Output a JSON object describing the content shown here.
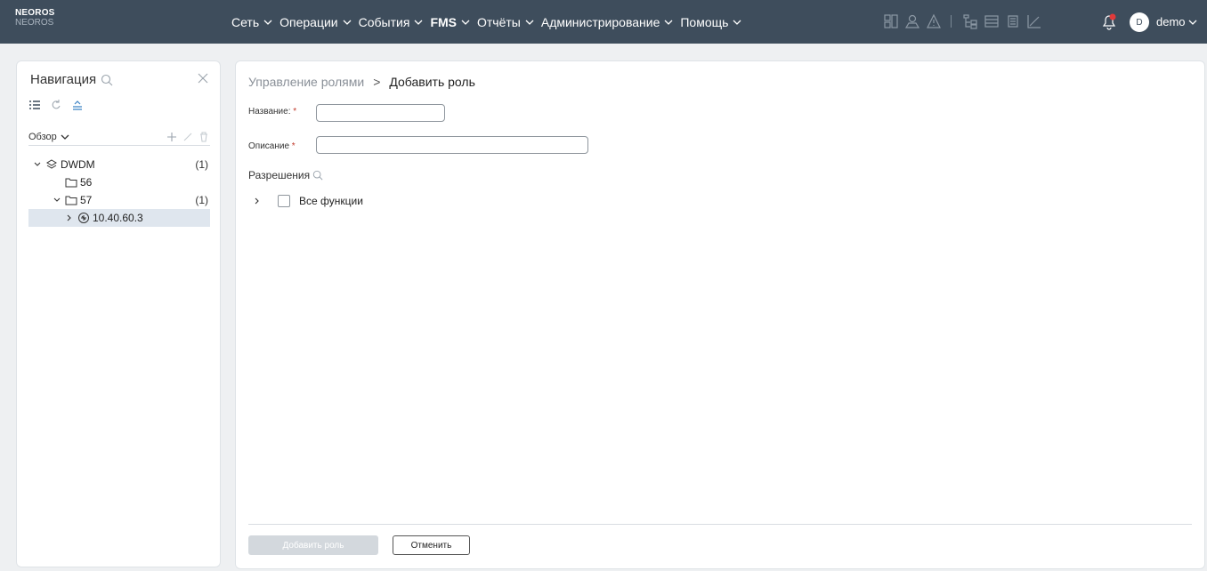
{
  "brand": {
    "name": "NEOROS",
    "subname": "NEOROS"
  },
  "menu": [
    {
      "label": "Сеть",
      "bold": false
    },
    {
      "label": "Операции",
      "bold": false
    },
    {
      "label": "События",
      "bold": false
    },
    {
      "label": "FMS",
      "bold": true
    },
    {
      "label": "Отчёты",
      "bold": false
    },
    {
      "label": "Администрирование",
      "bold": false
    },
    {
      "label": "Помощь",
      "bold": false
    }
  ],
  "toolbar_icons": [
    "topology-icon",
    "map-icon",
    "alarm-icon",
    "tree-icon",
    "table-icon",
    "inventory-icon",
    "chart-icon"
  ],
  "user": {
    "avatar_letter": "D",
    "name": "demo"
  },
  "nav": {
    "title": "Навигация",
    "overview_label": "Обзор",
    "tree": [
      {
        "label": "DWDM",
        "count": "(1)",
        "level": 0,
        "expanded": true,
        "icon": "layers-icon"
      },
      {
        "label": "56",
        "count": "",
        "level": 1,
        "expanded": false,
        "icon": "folder-icon"
      },
      {
        "label": "57",
        "count": "(1)",
        "level": 1,
        "expanded": true,
        "icon": "folder-icon"
      },
      {
        "label": "10.40.60.3",
        "count": "",
        "level": 2,
        "expanded": false,
        "icon": "device-icon",
        "selected": true
      }
    ]
  },
  "main": {
    "breadcrumb": {
      "parent": "Управление ролями",
      "separator": ">",
      "current": "Добавить роль"
    },
    "name_label": "Название:",
    "name_value": "",
    "description_label": "Описание",
    "description_value": "",
    "required_mark": "*",
    "permissions_title": "Разрешения",
    "all_functions_label": "Все функции",
    "add_button": "Добавить роль",
    "cancel_button": "Отменить"
  },
  "colors": {
    "topbar": "#3e4d5c",
    "selected_row": "#dfe6ee",
    "required": "#c0392b",
    "disabled_button": "#d3d8dd"
  }
}
